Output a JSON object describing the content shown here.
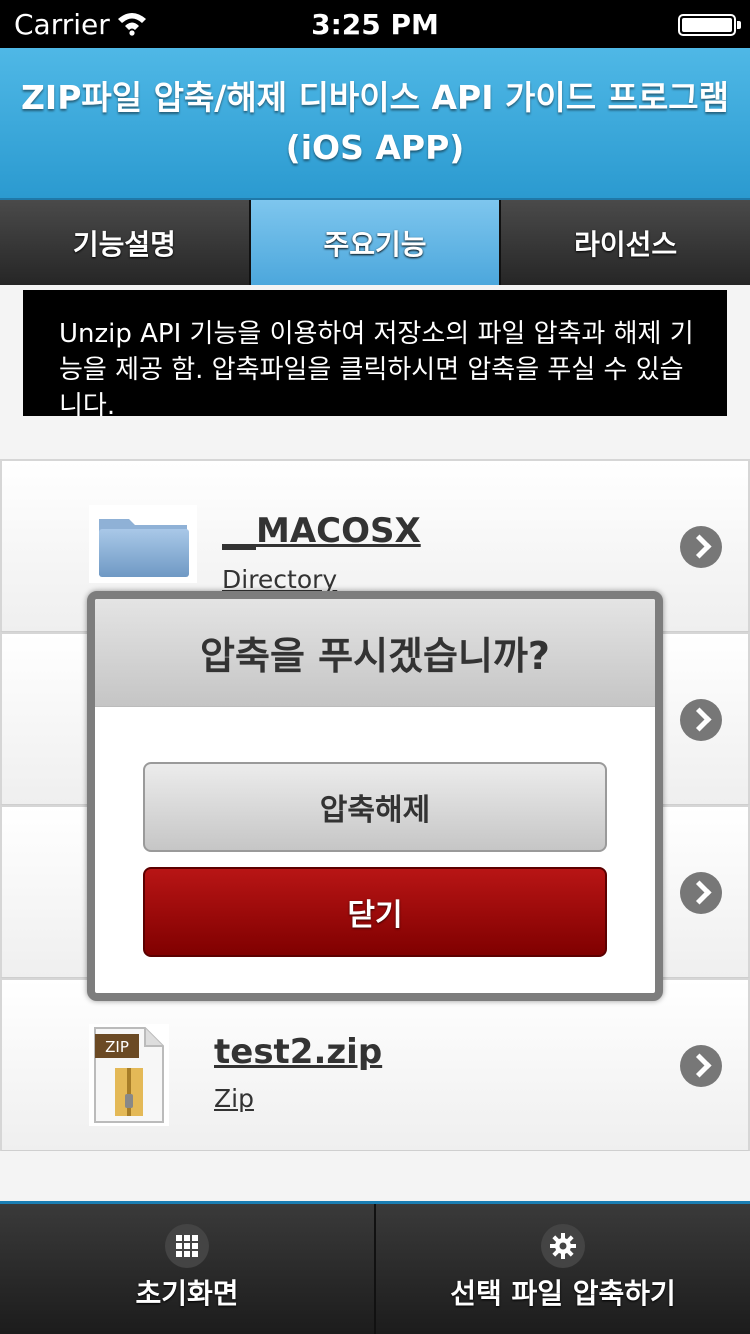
{
  "status_bar": {
    "carrier": "Carrier",
    "time": "3:25 PM"
  },
  "header": {
    "title_line1": "ZIP파일 압축/해제 디바이스 API 가이드 프로그램",
    "title_line2": "(iOS APP)"
  },
  "tabs": [
    {
      "label": "기능설명",
      "active": false
    },
    {
      "label": "주요기능",
      "active": true
    },
    {
      "label": "라이선스",
      "active": false
    }
  ],
  "description": "Unzip API 기능을 이용하여 저장소의 파일 압축과 해제 기능을 제공 함. 압축파일을 클릭하시면 압축을 푸실 수 있습니다.",
  "files": [
    {
      "name": "__MACOSX",
      "type": "Directory",
      "icon": "folder-icon"
    },
    {
      "name": "",
      "type": "",
      "icon": ""
    },
    {
      "name": "",
      "type": "",
      "icon": ""
    },
    {
      "name": "test2.zip",
      "type": "Zip",
      "icon": "zip-file-icon",
      "icon_label": "ZIP"
    }
  ],
  "dialog": {
    "title": "압축을 푸시겠습니까?",
    "extract_label": "압축해제",
    "close_label": "닫기"
  },
  "bottom_bar": {
    "home_label": "초기화면",
    "compress_label": "선택 파일 압축하기"
  },
  "colors": {
    "header_blue": "#2b9ad0",
    "active_tab": "#4ca7dc",
    "close_button": "#a00e0e"
  }
}
